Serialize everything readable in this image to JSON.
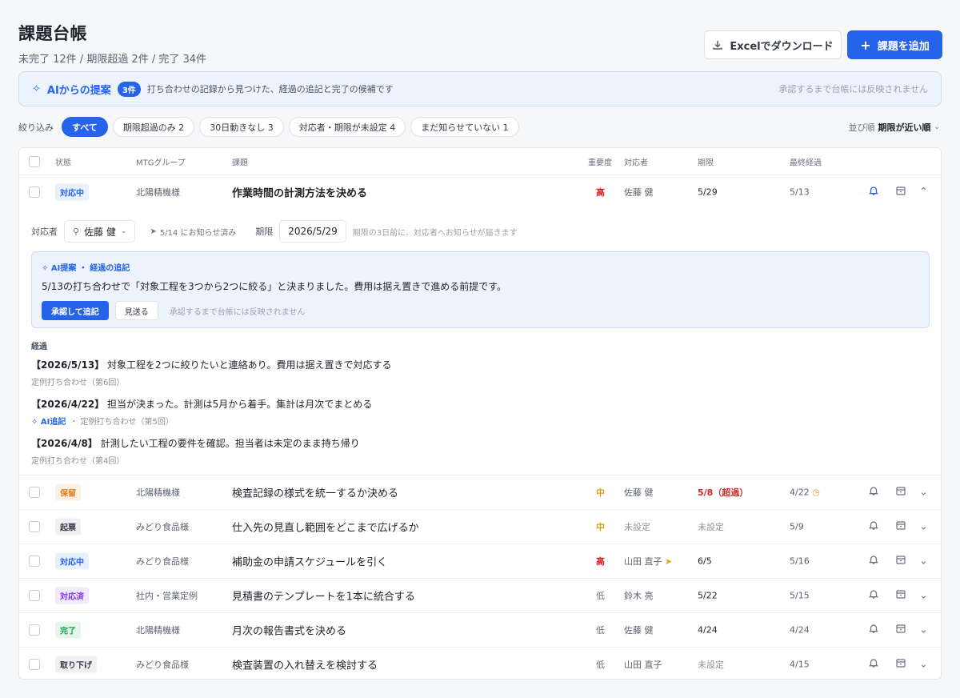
{
  "header": {
    "title": "課題台帳",
    "subtitle": "未完了 12件 / 期限超過 2件 / 完了 34件",
    "excel_label": "Excelでダウンロード",
    "add_label": "課題を追加"
  },
  "ai_banner": {
    "title": "AIからの提案",
    "badge": "3件",
    "desc": "打ち合わせの記録から見つけた、経過の追記と完了の候補です",
    "note": "承認するまで台帳には反映されません"
  },
  "filters": {
    "label": "絞り込み",
    "chips": [
      "すべて",
      "期限超過のみ 2",
      "30日動きなし 3",
      "対応者・期限が未設定 4",
      "まだ知らせていない 1"
    ]
  },
  "sort": {
    "label": "並び順",
    "value": "期限が近い順"
  },
  "table": {
    "headers": {
      "status": "状態",
      "group": "MTGグループ",
      "issue": "課題",
      "priority": "重要度",
      "owner": "対応者",
      "due": "期限",
      "last": "最終経過"
    },
    "expanded": {
      "status": "対応中",
      "group": "北陽精機様",
      "issue": "作業時間の計測方法を決める",
      "priority": "高",
      "owner": "佐藤 健",
      "due": "5/29",
      "last": "5/13"
    },
    "detail": {
      "owner_label": "対応者",
      "owner_value": "佐藤 健",
      "notified": "5/14 にお知らせ済み",
      "due_label": "期限",
      "due_value": "2026/5/29",
      "due_hint": "期限の3日前に、対応者へお知らせが届きます",
      "ai_card_title": "AI提案 ・ 経過の追記",
      "ai_card_body": "5/13の打ち合わせで「対象工程を3つから2つに絞る」と決まりました。費用は据え置きで進める前提です。",
      "approve": "承認して追記",
      "skip": "見送る",
      "ai_card_note": "承認するまで台帳には反映されません",
      "history_label": "経過",
      "history": [
        {
          "date": "【2026/5/13】",
          "text": "対象工程を2つに絞りたいと連絡あり。費用は据え置きで対応する",
          "meta": "定例打ち合わせ（第6回）",
          "ai": ""
        },
        {
          "date": "【2026/4/22】",
          "text": "担当が決まった。計測は5月から着手。集計は月次でまとめる",
          "meta": "・ 定例打ち合わせ（第5回）",
          "ai": "AI追記"
        },
        {
          "date": "【2026/4/8】",
          "text": "計測したい工程の要件を確認。担当者は未定のまま持ち帰り",
          "meta": "定例打ち合わせ（第4回）",
          "ai": ""
        }
      ]
    },
    "rows": [
      {
        "status": "保留",
        "group": "北陽精機様",
        "issue": "検査記録の様式を統一するか決める",
        "priority": "中",
        "owner": "佐藤 健",
        "due": "5/8（超過）",
        "last": "4/22"
      },
      {
        "status": "起票",
        "group": "みどり食品様",
        "issue": "仕入先の見直し範囲をどこまで広げるか",
        "priority": "中",
        "owner": "未設定",
        "due": "未設定",
        "last": "5/9"
      },
      {
        "status": "対応中",
        "group": "みどり食品様",
        "issue": "補助金の申請スケジュールを引く",
        "priority": "高",
        "owner": "山田 直子",
        "due": "6/5",
        "last": "5/16"
      },
      {
        "status": "対応済",
        "group": "社内・営業定例",
        "issue": "見積書のテンプレートを1本に統合する",
        "priority": "低",
        "owner": "鈴木 亮",
        "due": "5/22",
        "last": "5/15"
      },
      {
        "status": "完了",
        "group": "北陽精機様",
        "issue": "月次の報告書式を決める",
        "priority": "低",
        "owner": "佐藤 健",
        "due": "4/24",
        "last": "4/24"
      },
      {
        "status": "取り下げ",
        "group": "みどり食品様",
        "issue": "検査装置の入れ替えを検討する",
        "priority": "低",
        "owner": "山田 直子",
        "due": "未設定",
        "last": "4/15"
      }
    ]
  }
}
